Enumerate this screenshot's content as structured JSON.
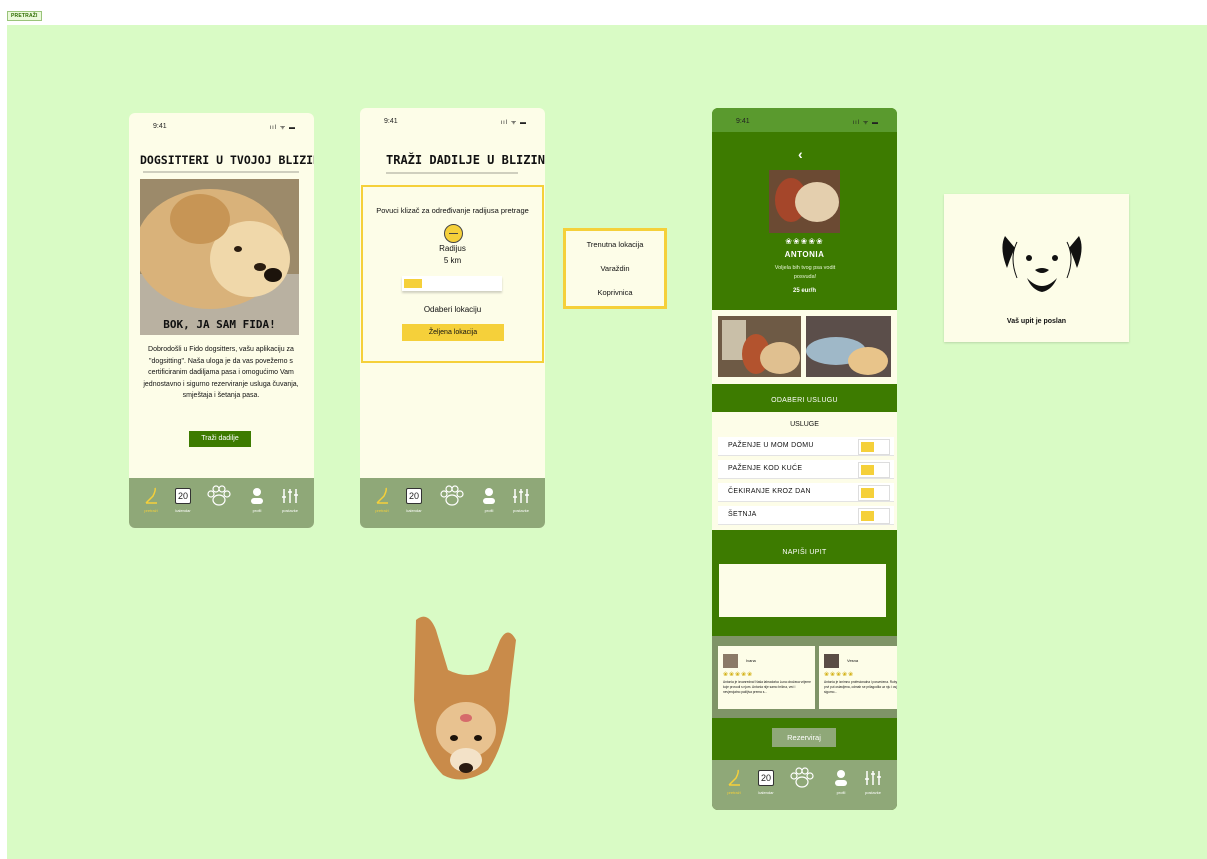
{
  "tag": "PRETRAŽI",
  "status": {
    "time": "9:41",
    "icons": "ııl ᯤ ▬"
  },
  "tabbar": [
    {
      "label": "pretraži",
      "icon": "search-nose-icon"
    },
    {
      "label": "kalendar",
      "icon": "calendar-icon",
      "day": "20"
    },
    {
      "label": "",
      "icon": "paw-icon"
    },
    {
      "label": "profil",
      "icon": "profile-icon"
    },
    {
      "label": "postavke",
      "icon": "settings-sliders-icon"
    }
  ],
  "screen1": {
    "title": "DOGSITTERI U TVOJOJ BLIZINI",
    "hero_caption": "BOK, JA SAM FIDA!",
    "body": "Dobrodošli u Fido dogsitters, vašu aplikaciju za \"dogsitting\". Naša uloga je da vas povežemo s certificiranim dadiljama pasa i omogućimo Vam jednostavno i sigurno rezerviranje usluga čuvanja, smještaja i šetanja pasa.",
    "button": "Traži dadilje"
  },
  "screen2": {
    "title": "TRAŽI DADILJE U BLIZINI",
    "instruction": "Povuci klizač za određivanje radijusa pretrage",
    "radius_label": "Radijus",
    "radius_value": "5 km",
    "location_label": "Odaberi lokaciju",
    "location_button": "Željena lokacija"
  },
  "dropdown": {
    "options": [
      "Trenutna lokacija",
      "Varaždin",
      "Koprivnica"
    ]
  },
  "profile": {
    "name": "ANTONIA",
    "stars": "❀❀❀❀❀",
    "tagline": "Voljela bih tvog psa vodit posvuda!",
    "price": "25 eur/h",
    "services_header": "ODABERI USLUGU",
    "services_sub": "USLUGE",
    "services": [
      "PAŽENJE U MOM DOMU",
      "PAŽENJE KOD KUĆE",
      "ČEKIRANJE KROZ DAN",
      "ŠETNJA"
    ],
    "query_header": "NAPIŠI UPIT",
    "reviews": [
      {
        "name": "Ivana",
        "stars": "❀❀❀❀❀",
        "text": "Antonia je izvanredna! Naša labradorka Luna obožava vrijeme koje provodi s njom. Antonia nije samo brižna, već i nevjerojatno pažljiva prema s..."
      },
      {
        "name": "Vesna",
        "stars": "❀❀❀❀❀",
        "text": "Antonia je iznimno profesionalna i posvećena. Ruby se je pri prvi put ostavljena, odmah se prilagodila uz nju i osjećala se sigurno..."
      }
    ],
    "reserve_button": "Rezerviraj"
  },
  "confirmation": {
    "message": "Vaš upit je poslan"
  },
  "colors": {
    "canvas": "#d9fbc5",
    "accent": "#f5d03a",
    "green": "#3d7b00",
    "tabbar": "#8fa878",
    "screen": "#fdfde8"
  }
}
